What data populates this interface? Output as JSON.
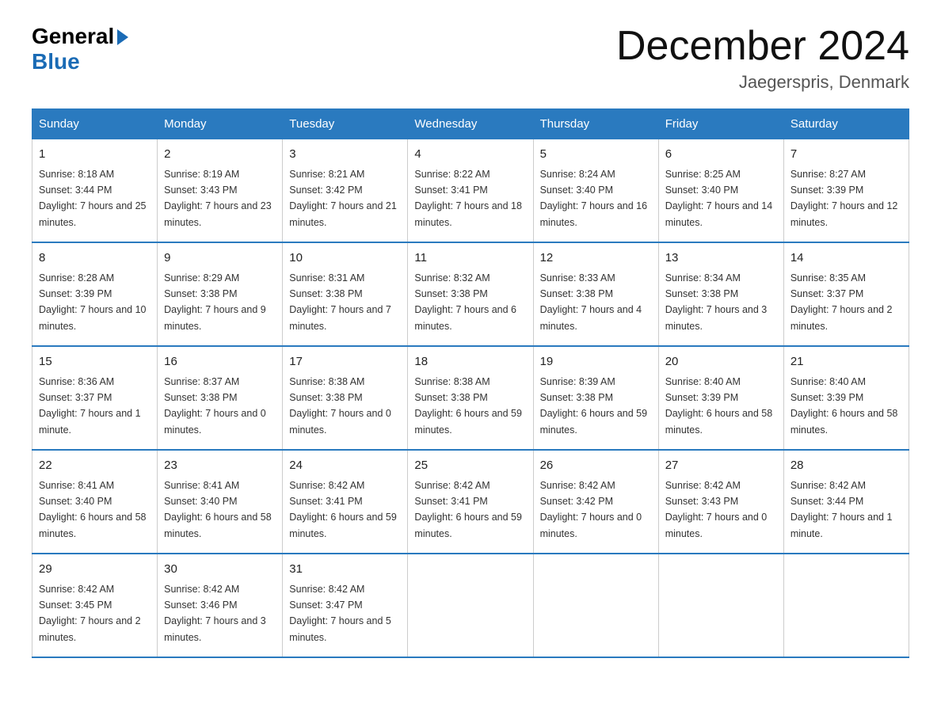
{
  "header": {
    "logo_general": "General",
    "logo_blue": "Blue",
    "month_year": "December 2024",
    "location": "Jaegerspris, Denmark"
  },
  "days_of_week": [
    "Sunday",
    "Monday",
    "Tuesday",
    "Wednesday",
    "Thursday",
    "Friday",
    "Saturday"
  ],
  "weeks": [
    [
      {
        "day": "1",
        "sunrise": "8:18 AM",
        "sunset": "3:44 PM",
        "daylight": "7 hours and 25 minutes."
      },
      {
        "day": "2",
        "sunrise": "8:19 AM",
        "sunset": "3:43 PM",
        "daylight": "7 hours and 23 minutes."
      },
      {
        "day": "3",
        "sunrise": "8:21 AM",
        "sunset": "3:42 PM",
        "daylight": "7 hours and 21 minutes."
      },
      {
        "day": "4",
        "sunrise": "8:22 AM",
        "sunset": "3:41 PM",
        "daylight": "7 hours and 18 minutes."
      },
      {
        "day": "5",
        "sunrise": "8:24 AM",
        "sunset": "3:40 PM",
        "daylight": "7 hours and 16 minutes."
      },
      {
        "day": "6",
        "sunrise": "8:25 AM",
        "sunset": "3:40 PM",
        "daylight": "7 hours and 14 minutes."
      },
      {
        "day": "7",
        "sunrise": "8:27 AM",
        "sunset": "3:39 PM",
        "daylight": "7 hours and 12 minutes."
      }
    ],
    [
      {
        "day": "8",
        "sunrise": "8:28 AM",
        "sunset": "3:39 PM",
        "daylight": "7 hours and 10 minutes."
      },
      {
        "day": "9",
        "sunrise": "8:29 AM",
        "sunset": "3:38 PM",
        "daylight": "7 hours and 9 minutes."
      },
      {
        "day": "10",
        "sunrise": "8:31 AM",
        "sunset": "3:38 PM",
        "daylight": "7 hours and 7 minutes."
      },
      {
        "day": "11",
        "sunrise": "8:32 AM",
        "sunset": "3:38 PM",
        "daylight": "7 hours and 6 minutes."
      },
      {
        "day": "12",
        "sunrise": "8:33 AM",
        "sunset": "3:38 PM",
        "daylight": "7 hours and 4 minutes."
      },
      {
        "day": "13",
        "sunrise": "8:34 AM",
        "sunset": "3:38 PM",
        "daylight": "7 hours and 3 minutes."
      },
      {
        "day": "14",
        "sunrise": "8:35 AM",
        "sunset": "3:37 PM",
        "daylight": "7 hours and 2 minutes."
      }
    ],
    [
      {
        "day": "15",
        "sunrise": "8:36 AM",
        "sunset": "3:37 PM",
        "daylight": "7 hours and 1 minute."
      },
      {
        "day": "16",
        "sunrise": "8:37 AM",
        "sunset": "3:38 PM",
        "daylight": "7 hours and 0 minutes."
      },
      {
        "day": "17",
        "sunrise": "8:38 AM",
        "sunset": "3:38 PM",
        "daylight": "7 hours and 0 minutes."
      },
      {
        "day": "18",
        "sunrise": "8:38 AM",
        "sunset": "3:38 PM",
        "daylight": "6 hours and 59 minutes."
      },
      {
        "day": "19",
        "sunrise": "8:39 AM",
        "sunset": "3:38 PM",
        "daylight": "6 hours and 59 minutes."
      },
      {
        "day": "20",
        "sunrise": "8:40 AM",
        "sunset": "3:39 PM",
        "daylight": "6 hours and 58 minutes."
      },
      {
        "day": "21",
        "sunrise": "8:40 AM",
        "sunset": "3:39 PM",
        "daylight": "6 hours and 58 minutes."
      }
    ],
    [
      {
        "day": "22",
        "sunrise": "8:41 AM",
        "sunset": "3:40 PM",
        "daylight": "6 hours and 58 minutes."
      },
      {
        "day": "23",
        "sunrise": "8:41 AM",
        "sunset": "3:40 PM",
        "daylight": "6 hours and 58 minutes."
      },
      {
        "day": "24",
        "sunrise": "8:42 AM",
        "sunset": "3:41 PM",
        "daylight": "6 hours and 59 minutes."
      },
      {
        "day": "25",
        "sunrise": "8:42 AM",
        "sunset": "3:41 PM",
        "daylight": "6 hours and 59 minutes."
      },
      {
        "day": "26",
        "sunrise": "8:42 AM",
        "sunset": "3:42 PM",
        "daylight": "7 hours and 0 minutes."
      },
      {
        "day": "27",
        "sunrise": "8:42 AM",
        "sunset": "3:43 PM",
        "daylight": "7 hours and 0 minutes."
      },
      {
        "day": "28",
        "sunrise": "8:42 AM",
        "sunset": "3:44 PM",
        "daylight": "7 hours and 1 minute."
      }
    ],
    [
      {
        "day": "29",
        "sunrise": "8:42 AM",
        "sunset": "3:45 PM",
        "daylight": "7 hours and 2 minutes."
      },
      {
        "day": "30",
        "sunrise": "8:42 AM",
        "sunset": "3:46 PM",
        "daylight": "7 hours and 3 minutes."
      },
      {
        "day": "31",
        "sunrise": "8:42 AM",
        "sunset": "3:47 PM",
        "daylight": "7 hours and 5 minutes."
      },
      null,
      null,
      null,
      null
    ]
  ]
}
